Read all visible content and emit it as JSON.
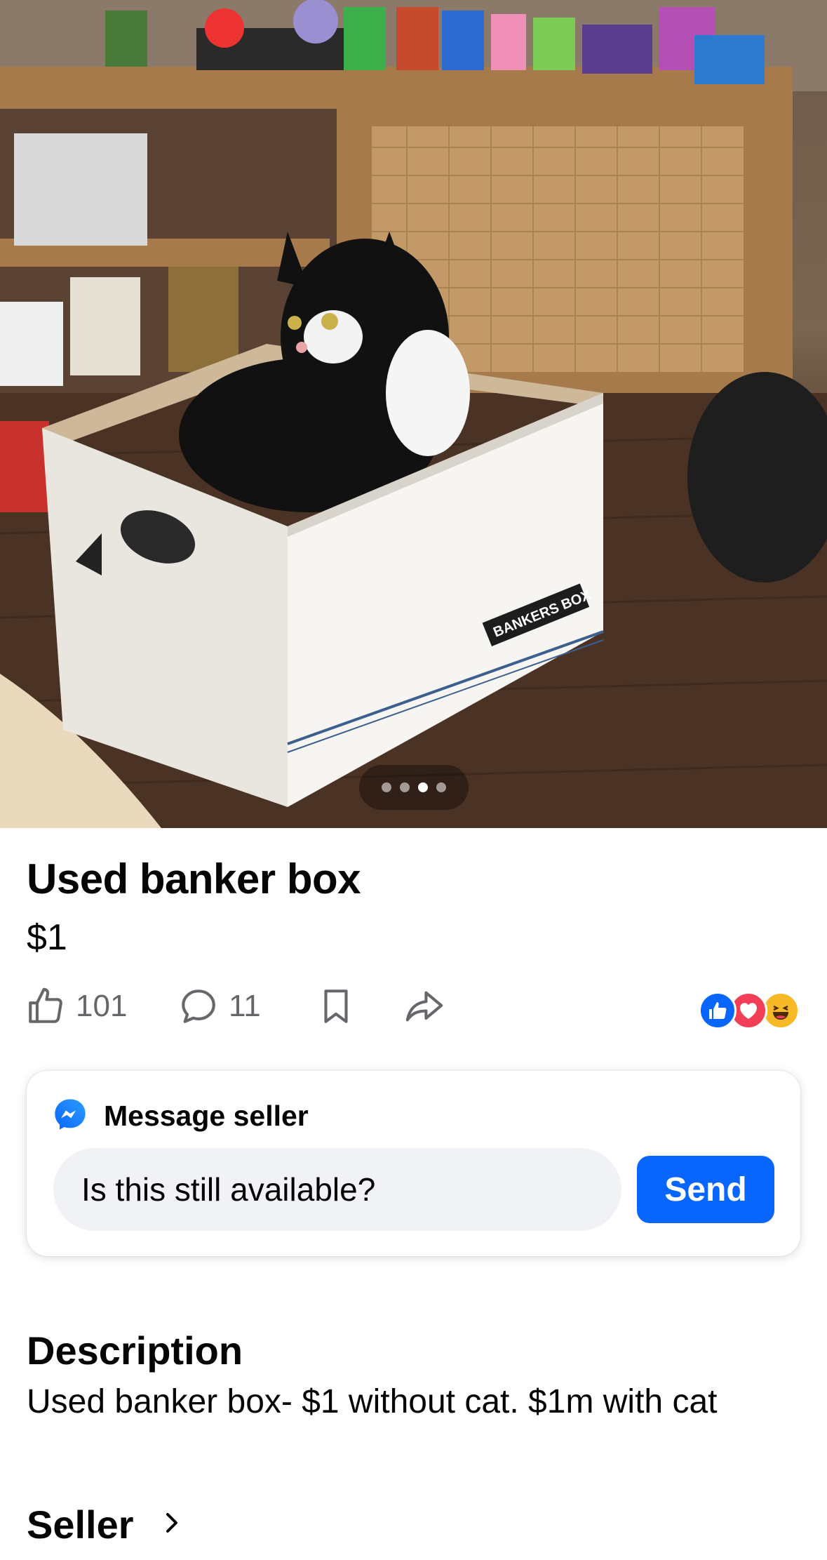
{
  "photo": {
    "alt_subject": "",
    "box_brand_text": "BANKERS BOX",
    "carousel": {
      "count": 4,
      "active_index": 2
    }
  },
  "listing": {
    "title": "Used banker box",
    "price": "$1"
  },
  "actions": {
    "like_icon": "thumbs-up-icon",
    "like_count": "101",
    "comment_icon": "comment-icon",
    "comment_count": "11",
    "save_icon": "bookmark-icon",
    "share_icon": "share-arrow-icon",
    "reactions": [
      "like",
      "love",
      "haha"
    ]
  },
  "message_card": {
    "icon": "messenger-icon",
    "heading": "Message seller",
    "input_value": "Is this still available?",
    "send_label": "Send"
  },
  "description": {
    "heading": "Description",
    "text": "Used banker box- $1 without cat. $1m with cat"
  },
  "seller": {
    "heading": "Seller",
    "chevron_icon": "chevron-right-icon"
  },
  "colors": {
    "accent_blue": "#0866ff",
    "love_red": "#f33e58",
    "haha_yellow": "#f7b928",
    "muted_text": "#65676b"
  }
}
